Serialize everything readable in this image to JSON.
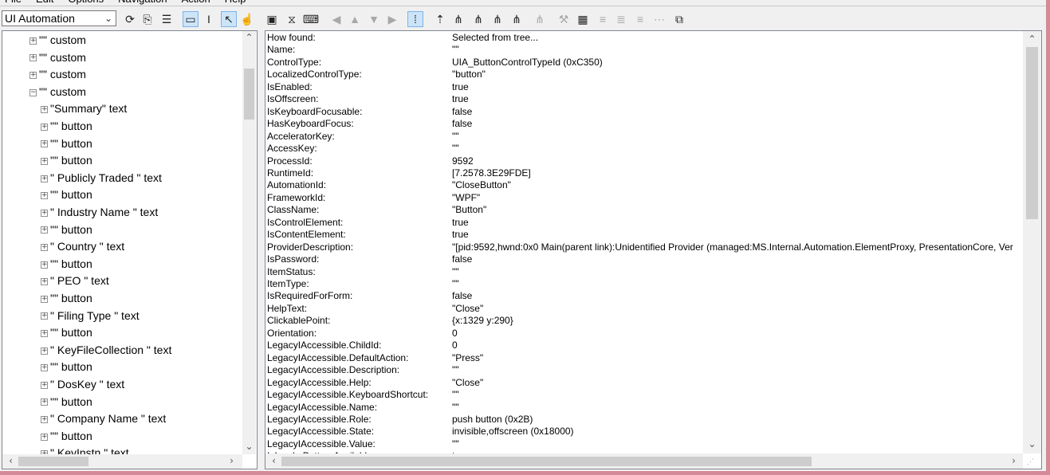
{
  "menu": [
    "File",
    "Edit",
    "Options",
    "Navigation",
    "Action",
    "Help"
  ],
  "toolbar": {
    "mode_value": "UI Automation",
    "buttons": [
      {
        "name": "refresh-icon",
        "glyph": "⟳"
      },
      {
        "name": "copy-icon",
        "glyph": "⎘"
      },
      {
        "name": "properties-icon",
        "glyph": "☰"
      },
      {
        "name": "highlight-rectangle-icon",
        "glyph": "▭"
      },
      {
        "name": "caret-icon",
        "glyph": "I"
      },
      {
        "name": "select-pointer-icon",
        "glyph": "↖"
      },
      {
        "name": "hover-track-icon",
        "glyph": "☝"
      },
      {
        "name": "focus-track-icon",
        "glyph": "▣"
      },
      {
        "name": "hourglass-icon",
        "glyph": "⧖"
      },
      {
        "name": "keyboard-icon",
        "glyph": "⌨"
      },
      {
        "name": "nav-back-icon",
        "glyph": "◀"
      },
      {
        "name": "nav-up-icon",
        "glyph": "▲"
      },
      {
        "name": "nav-down-icon",
        "glyph": "▼"
      },
      {
        "name": "nav-forward-icon",
        "glyph": "▶"
      },
      {
        "name": "tree-view-icon",
        "glyph": "⁞"
      },
      {
        "name": "goto-parent-icon",
        "glyph": "⇡"
      },
      {
        "name": "goto-first-child-icon",
        "glyph": "⋔"
      },
      {
        "name": "goto-prev-sibling-icon",
        "glyph": "⋔"
      },
      {
        "name": "goto-next-sibling-icon",
        "glyph": "⋔"
      },
      {
        "name": "goto-last-child-icon",
        "glyph": "⋔"
      },
      {
        "name": "goto-tree-icon",
        "glyph": "⋔"
      },
      {
        "name": "invoke-icon",
        "glyph": "⚒"
      },
      {
        "name": "pattern-icon",
        "glyph": "▦"
      },
      {
        "name": "action-1-icon",
        "glyph": "≡"
      },
      {
        "name": "action-2-icon",
        "glyph": "≣"
      },
      {
        "name": "action-3-icon",
        "glyph": "≡"
      },
      {
        "name": "action-4-icon",
        "glyph": "⋯"
      },
      {
        "name": "events-icon",
        "glyph": "⧉"
      }
    ]
  },
  "tree": [
    {
      "depth": 1,
      "state": "collapsed",
      "label": "\"\" custom"
    },
    {
      "depth": 1,
      "state": "collapsed",
      "label": "\"\" custom"
    },
    {
      "depth": 1,
      "state": "collapsed",
      "label": "\"\" custom"
    },
    {
      "depth": 1,
      "state": "expanded",
      "label": "\"\" custom"
    },
    {
      "depth": 2,
      "state": "collapsed",
      "label": "\"Summary\" text"
    },
    {
      "depth": 2,
      "state": "collapsed",
      "label": "\"\" button"
    },
    {
      "depth": 2,
      "state": "collapsed",
      "label": "\"\" button"
    },
    {
      "depth": 2,
      "state": "collapsed",
      "label": "\"\" button"
    },
    {
      "depth": 2,
      "state": "collapsed",
      "label": "\" Publicly Traded  \" text"
    },
    {
      "depth": 2,
      "state": "collapsed",
      "label": "\"\" button"
    },
    {
      "depth": 2,
      "state": "collapsed",
      "label": "\" Industry Name  \" text"
    },
    {
      "depth": 2,
      "state": "collapsed",
      "label": "\"\" button"
    },
    {
      "depth": 2,
      "state": "collapsed",
      "label": "\" Country  \" text"
    },
    {
      "depth": 2,
      "state": "collapsed",
      "label": "\"\" button"
    },
    {
      "depth": 2,
      "state": "collapsed",
      "label": "\" PEO  \" text"
    },
    {
      "depth": 2,
      "state": "collapsed",
      "label": "\"\" button"
    },
    {
      "depth": 2,
      "state": "collapsed",
      "label": "\" Filing Type  \" text"
    },
    {
      "depth": 2,
      "state": "collapsed",
      "label": "\"\" button"
    },
    {
      "depth": 2,
      "state": "collapsed",
      "label": "\" KeyFileCollection  \" text"
    },
    {
      "depth": 2,
      "state": "collapsed",
      "label": "\"\" button"
    },
    {
      "depth": 2,
      "state": "collapsed",
      "label": "\" DosKey  \" text"
    },
    {
      "depth": 2,
      "state": "collapsed",
      "label": "\"\" button"
    },
    {
      "depth": 2,
      "state": "collapsed",
      "label": "\" Company Name  \" text"
    },
    {
      "depth": 2,
      "state": "collapsed",
      "label": "\"\" button"
    },
    {
      "depth": 2,
      "state": "collapsed",
      "label": "\" KeyInstn  \" text"
    }
  ],
  "properties": [
    {
      "name": "How found:",
      "value": "Selected from tree..."
    },
    {
      "name": "Name:",
      "value": "\"\""
    },
    {
      "name": "ControlType:",
      "value": "UIA_ButtonControlTypeId (0xC350)"
    },
    {
      "name": "LocalizedControlType:",
      "value": "\"button\""
    },
    {
      "name": "IsEnabled:",
      "value": "true"
    },
    {
      "name": "IsOffscreen:",
      "value": "true"
    },
    {
      "name": "IsKeyboardFocusable:",
      "value": "false"
    },
    {
      "name": "HasKeyboardFocus:",
      "value": "false"
    },
    {
      "name": "AcceleratorKey:",
      "value": "\"\""
    },
    {
      "name": "AccessKey:",
      "value": "\"\""
    },
    {
      "name": "ProcessId:",
      "value": "9592"
    },
    {
      "name": "RuntimeId:",
      "value": "[7.2578.3E29FDE]"
    },
    {
      "name": "AutomationId:",
      "value": "\"CloseButton\""
    },
    {
      "name": "FrameworkId:",
      "value": "\"WPF\""
    },
    {
      "name": "ClassName:",
      "value": "\"Button\""
    },
    {
      "name": "IsControlElement:",
      "value": "true"
    },
    {
      "name": "IsContentElement:",
      "value": "true"
    },
    {
      "name": "ProviderDescription:",
      "value": "\"[pid:9592,hwnd:0x0 Main(parent link):Unidentified Provider (managed:MS.Internal.Automation.ElementProxy, PresentationCore, Ver"
    },
    {
      "name": "IsPassword:",
      "value": "false"
    },
    {
      "name": "ItemStatus:",
      "value": "\"\""
    },
    {
      "name": "ItemType:",
      "value": "\"\""
    },
    {
      "name": "IsRequiredForForm:",
      "value": "false"
    },
    {
      "name": "HelpText:",
      "value": "\"Close\""
    },
    {
      "name": "ClickablePoint:",
      "value": "{x:1329 y:290}"
    },
    {
      "name": "Orientation:",
      "value": "0"
    },
    {
      "name": "LegacyIAccessible.ChildId:",
      "value": "0"
    },
    {
      "name": "LegacyIAccessible.DefaultAction:",
      "value": "\"Press\""
    },
    {
      "name": "LegacyIAccessible.Description:",
      "value": "\"\""
    },
    {
      "name": "LegacyIAccessible.Help:",
      "value": "\"Close\""
    },
    {
      "name": "LegacyIAccessible.KeyboardShortcut:",
      "value": "\"\""
    },
    {
      "name": "LegacyIAccessible.Name:",
      "value": "\"\""
    },
    {
      "name": "LegacyIAccessible.Role:",
      "value": "push button (0x2B)"
    },
    {
      "name": "LegacyIAccessible.State:",
      "value": "invisible,offscreen (0x18000)"
    },
    {
      "name": "LegacyIAccessible.Value:",
      "value": "\"\""
    },
    {
      "name": "IsInvokePatternAvailable:",
      "value": "true"
    }
  ]
}
